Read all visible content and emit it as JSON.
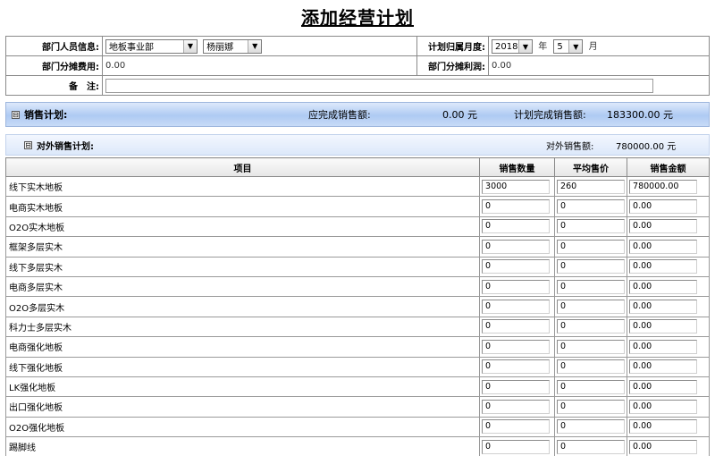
{
  "page_title": "添加经营计划",
  "form": {
    "dept_label": "部门人员信息:",
    "dept_value": "地板事业部",
    "person_value": "杨丽娜",
    "period_label": "计划归属月度:",
    "year_value": "2018",
    "year_unit": "年",
    "month_value": "5",
    "month_unit": "月",
    "cost_label": "部门分摊费用:",
    "cost_value": "0.00",
    "profit_label": "部门分摊利润:",
    "profit_value": "0.00",
    "memo_label": "备　注:",
    "memo_value": ""
  },
  "sales_plan": {
    "toggle": "⊟",
    "label": "销售计划:",
    "due_label": "应完成销售额:",
    "due_value": "0.00 元",
    "plan_label": "计划完成销售额:",
    "plan_value": "183300.00 元"
  },
  "external_plan": {
    "toggle": "⊟",
    "label": "对外销售计划:",
    "amount_label": "对外销售额:",
    "amount_value": "780000.00 元"
  },
  "table": {
    "headers": [
      "项目",
      "销售数量",
      "平均售价",
      "销售金额"
    ],
    "rows": [
      {
        "item": "线下实木地板",
        "qty": "3000",
        "price": "260",
        "amount": "780000.00"
      },
      {
        "item": "电商实木地板",
        "qty": "0",
        "price": "0",
        "amount": "0.00"
      },
      {
        "item": "O2O实木地板",
        "qty": "0",
        "price": "0",
        "amount": "0.00"
      },
      {
        "item": "框架多层实木",
        "qty": "0",
        "price": "0",
        "amount": "0.00"
      },
      {
        "item": "线下多层实木",
        "qty": "0",
        "price": "0",
        "amount": "0.00"
      },
      {
        "item": "电商多层实木",
        "qty": "0",
        "price": "0",
        "amount": "0.00"
      },
      {
        "item": "O2O多层实木",
        "qty": "0",
        "price": "0",
        "amount": "0.00"
      },
      {
        "item": "科力士多层实木",
        "qty": "0",
        "price": "0",
        "amount": "0.00"
      },
      {
        "item": "电商强化地板",
        "qty": "0",
        "price": "0",
        "amount": "0.00"
      },
      {
        "item": "线下强化地板",
        "qty": "0",
        "price": "0",
        "amount": "0.00"
      },
      {
        "item": "LK强化地板",
        "qty": "0",
        "price": "0",
        "amount": "0.00"
      },
      {
        "item": "出口强化地板",
        "qty": "0",
        "price": "0",
        "amount": "0.00"
      },
      {
        "item": "O2O强化地板",
        "qty": "0",
        "price": "0",
        "amount": "0.00"
      },
      {
        "item": "踢脚线",
        "qty": "0",
        "price": "0",
        "amount": "0.00"
      }
    ]
  },
  "icons": {
    "dropdown": "chevron-down-icon",
    "collapse": "collapse-toggle-icon"
  }
}
